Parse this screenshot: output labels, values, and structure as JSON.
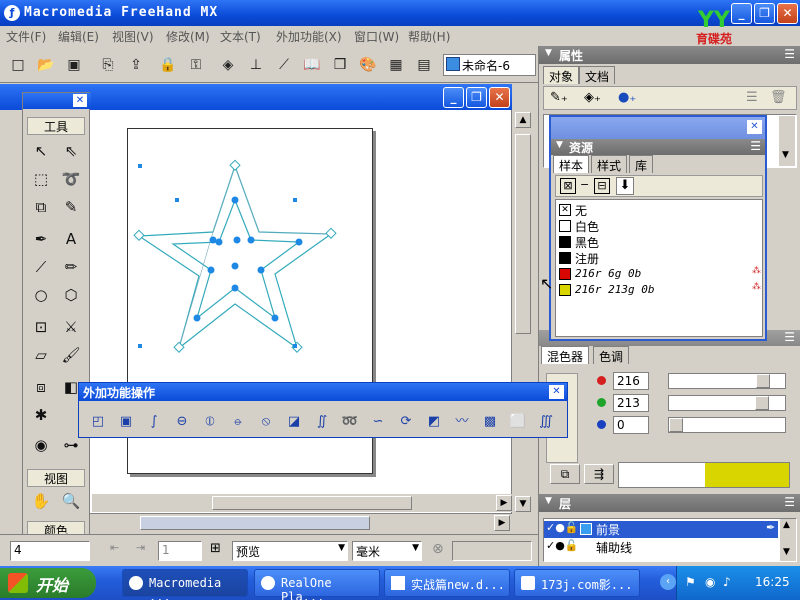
{
  "window": {
    "title": "Macromedia FreeHand MX"
  },
  "logo_text": "育碟苑",
  "menu": [
    "文件(F)",
    "编辑(E)",
    "视图(V)",
    "修改(M)",
    "文本(T)",
    "外加功能(X)",
    "窗口(W)",
    "帮助(H)"
  ],
  "document": {
    "name": "未命名-6"
  },
  "tools": {
    "title": "工具",
    "view_label": "视图",
    "color_label": "颜色"
  },
  "properties": {
    "title": "属性",
    "tabs": [
      "对象",
      "文档"
    ]
  },
  "assets": {
    "title": "资源",
    "tabs": [
      "样本",
      "样式",
      "库"
    ]
  },
  "swatches": [
    {
      "label": "无",
      "color": "none",
      "italic": false
    },
    {
      "label": "白色",
      "color": "#ffffff",
      "italic": false
    },
    {
      "label": "黑色",
      "color": "#000000",
      "italic": false
    },
    {
      "label": "注册",
      "color": "#000000",
      "italic": false
    },
    {
      "label": "216r 6g 0b",
      "color": "#d80600",
      "italic": true
    },
    {
      "label": "216r 213g 0b",
      "color": "#d8d500",
      "italic": true
    }
  ],
  "xtra_panel": {
    "title": "外加功能操作"
  },
  "mixer": {
    "tabs": [
      "混色器",
      "色调"
    ],
    "r": {
      "value": "216",
      "level": 0.85
    },
    "g": {
      "value": "213",
      "level": 0.84
    },
    "b": {
      "value": "0",
      "level": 0.0
    },
    "preview_color": "#d8d500"
  },
  "layers": {
    "title": "层",
    "items": [
      {
        "name": "前景",
        "selected": true
      },
      {
        "name": "辅助线",
        "selected": false
      }
    ]
  },
  "statusbar": {
    "zoom": "4",
    "page": "1",
    "view_mode": "预览",
    "units": "毫米"
  },
  "taskbar": {
    "start": "开始",
    "tasks": [
      "Macromedia ...",
      "RealOne Pla...",
      "实战篇new.d...",
      "173j.com影..."
    ],
    "clock": "16:25"
  },
  "colors": {
    "star_stroke": "#33aabb",
    "point": "#1e88e5",
    "accent": "#0b4bd8"
  }
}
